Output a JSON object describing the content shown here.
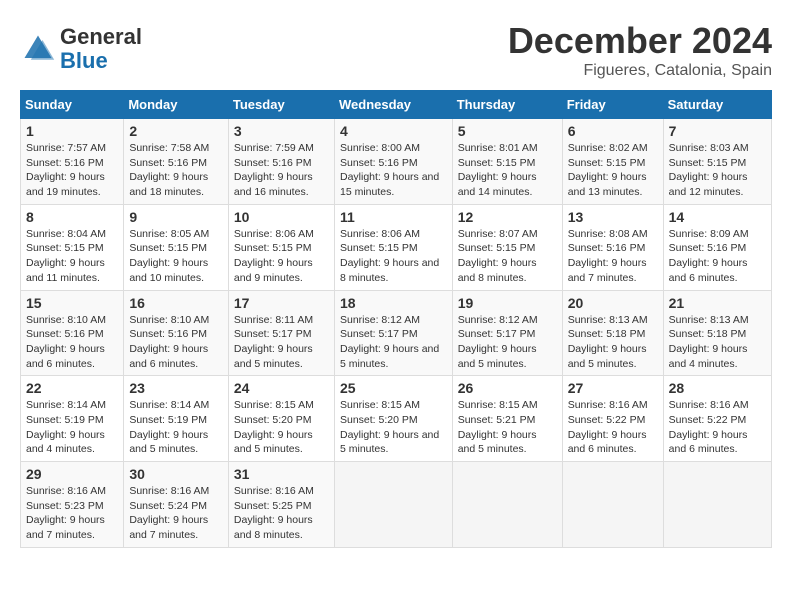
{
  "header": {
    "logo_general": "General",
    "logo_blue": "Blue",
    "title": "December 2024",
    "subtitle": "Figueres, Catalonia, Spain"
  },
  "calendar": {
    "days_of_week": [
      "Sunday",
      "Monday",
      "Tuesday",
      "Wednesday",
      "Thursday",
      "Friday",
      "Saturday"
    ],
    "weeks": [
      [
        null,
        null,
        null,
        null,
        {
          "day": "5",
          "sunrise": "8:01 AM",
          "sunset": "5:15 PM",
          "daylight": "9 hours and 14 minutes."
        },
        {
          "day": "6",
          "sunrise": "8:02 AM",
          "sunset": "5:15 PM",
          "daylight": "9 hours and 13 minutes."
        },
        {
          "day": "7",
          "sunrise": "8:03 AM",
          "sunset": "5:15 PM",
          "daylight": "9 hours and 12 minutes."
        }
      ],
      [
        {
          "day": "1",
          "sunrise": "7:57 AM",
          "sunset": "5:16 PM",
          "daylight": "9 hours and 19 minutes."
        },
        {
          "day": "2",
          "sunrise": "7:58 AM",
          "sunset": "5:16 PM",
          "daylight": "9 hours and 18 minutes."
        },
        {
          "day": "3",
          "sunrise": "7:59 AM",
          "sunset": "5:16 PM",
          "daylight": "9 hours and 16 minutes."
        },
        {
          "day": "4",
          "sunrise": "8:00 AM",
          "sunset": "5:16 PM",
          "daylight": "9 hours and 15 minutes."
        },
        {
          "day": "5",
          "sunrise": "8:01 AM",
          "sunset": "5:15 PM",
          "daylight": "9 hours and 14 minutes."
        },
        {
          "day": "6",
          "sunrise": "8:02 AM",
          "sunset": "5:15 PM",
          "daylight": "9 hours and 13 minutes."
        },
        {
          "day": "7",
          "sunrise": "8:03 AM",
          "sunset": "5:15 PM",
          "daylight": "9 hours and 12 minutes."
        }
      ],
      [
        {
          "day": "8",
          "sunrise": "8:04 AM",
          "sunset": "5:15 PM",
          "daylight": "9 hours and 11 minutes."
        },
        {
          "day": "9",
          "sunrise": "8:05 AM",
          "sunset": "5:15 PM",
          "daylight": "9 hours and 10 minutes."
        },
        {
          "day": "10",
          "sunrise": "8:06 AM",
          "sunset": "5:15 PM",
          "daylight": "9 hours and 9 minutes."
        },
        {
          "day": "11",
          "sunrise": "8:06 AM",
          "sunset": "5:15 PM",
          "daylight": "9 hours and 8 minutes."
        },
        {
          "day": "12",
          "sunrise": "8:07 AM",
          "sunset": "5:15 PM",
          "daylight": "9 hours and 8 minutes."
        },
        {
          "day": "13",
          "sunrise": "8:08 AM",
          "sunset": "5:16 PM",
          "daylight": "9 hours and 7 minutes."
        },
        {
          "day": "14",
          "sunrise": "8:09 AM",
          "sunset": "5:16 PM",
          "daylight": "9 hours and 6 minutes."
        }
      ],
      [
        {
          "day": "15",
          "sunrise": "8:10 AM",
          "sunset": "5:16 PM",
          "daylight": "9 hours and 6 minutes."
        },
        {
          "day": "16",
          "sunrise": "8:10 AM",
          "sunset": "5:16 PM",
          "daylight": "9 hours and 6 minutes."
        },
        {
          "day": "17",
          "sunrise": "8:11 AM",
          "sunset": "5:17 PM",
          "daylight": "9 hours and 5 minutes."
        },
        {
          "day": "18",
          "sunrise": "8:12 AM",
          "sunset": "5:17 PM",
          "daylight": "9 hours and 5 minutes."
        },
        {
          "day": "19",
          "sunrise": "8:12 AM",
          "sunset": "5:17 PM",
          "daylight": "9 hours and 5 minutes."
        },
        {
          "day": "20",
          "sunrise": "8:13 AM",
          "sunset": "5:18 PM",
          "daylight": "9 hours and 5 minutes."
        },
        {
          "day": "21",
          "sunrise": "8:13 AM",
          "sunset": "5:18 PM",
          "daylight": "9 hours and 4 minutes."
        }
      ],
      [
        {
          "day": "22",
          "sunrise": "8:14 AM",
          "sunset": "5:19 PM",
          "daylight": "9 hours and 4 minutes."
        },
        {
          "day": "23",
          "sunrise": "8:14 AM",
          "sunset": "5:19 PM",
          "daylight": "9 hours and 5 minutes."
        },
        {
          "day": "24",
          "sunrise": "8:15 AM",
          "sunset": "5:20 PM",
          "daylight": "9 hours and 5 minutes."
        },
        {
          "day": "25",
          "sunrise": "8:15 AM",
          "sunset": "5:20 PM",
          "daylight": "9 hours and 5 minutes."
        },
        {
          "day": "26",
          "sunrise": "8:15 AM",
          "sunset": "5:21 PM",
          "daylight": "9 hours and 5 minutes."
        },
        {
          "day": "27",
          "sunrise": "8:16 AM",
          "sunset": "5:22 PM",
          "daylight": "9 hours and 6 minutes."
        },
        {
          "day": "28",
          "sunrise": "8:16 AM",
          "sunset": "5:22 PM",
          "daylight": "9 hours and 6 minutes."
        }
      ],
      [
        {
          "day": "29",
          "sunrise": "8:16 AM",
          "sunset": "5:23 PM",
          "daylight": "9 hours and 7 minutes."
        },
        {
          "day": "30",
          "sunrise": "8:16 AM",
          "sunset": "5:24 PM",
          "daylight": "9 hours and 7 minutes."
        },
        {
          "day": "31",
          "sunrise": "8:16 AM",
          "sunset": "5:25 PM",
          "daylight": "9 hours and 8 minutes."
        },
        null,
        null,
        null,
        null
      ]
    ]
  }
}
